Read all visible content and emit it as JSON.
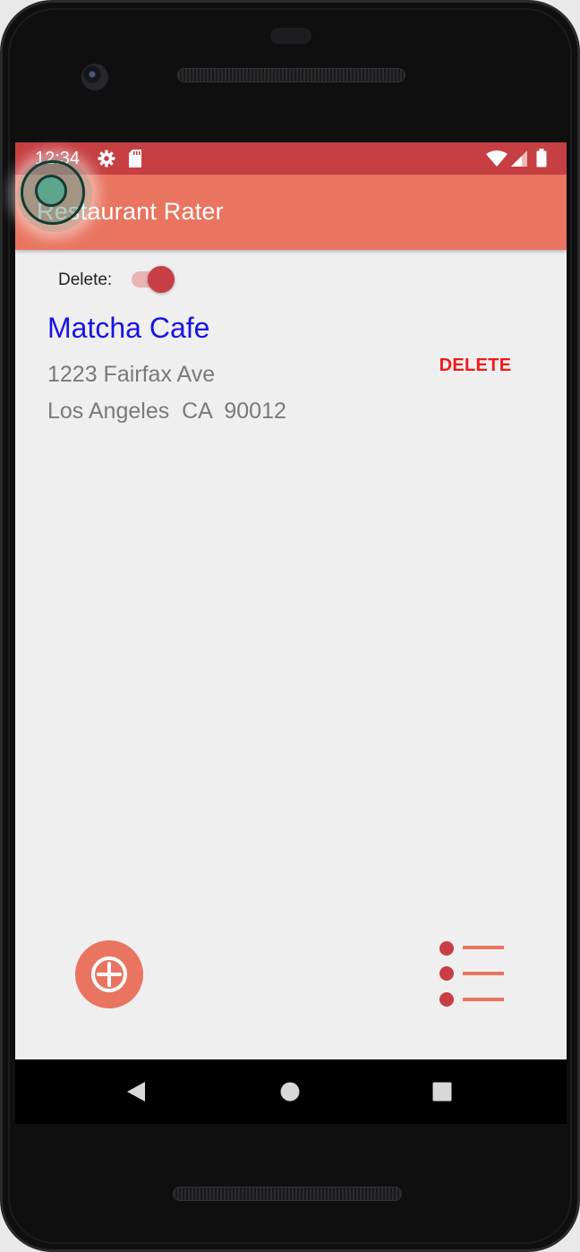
{
  "status_bar": {
    "time": "12:34",
    "icons": [
      "gear-icon",
      "sd-card-icon",
      "wifi-icon",
      "cell-signal-icon",
      "battery-icon"
    ],
    "color": "#c63f42"
  },
  "app_bar": {
    "title": "Restaurant Rater",
    "color": "#e97560"
  },
  "delete_toggle": {
    "label": "Delete:",
    "checked": true
  },
  "restaurants": [
    {
      "name": "Matcha Cafe",
      "street": "1223 Fairfax Ave",
      "city_line": "Los Angeles  CA  90012",
      "delete_label": "DELETE"
    }
  ],
  "fab": {
    "add_icon": "plus-icon",
    "list_icon": "list-icon",
    "accent": "#e97560"
  },
  "nav_bar": {
    "icons": [
      "back-triangle-icon",
      "home-circle-icon",
      "recents-square-icon"
    ]
  }
}
